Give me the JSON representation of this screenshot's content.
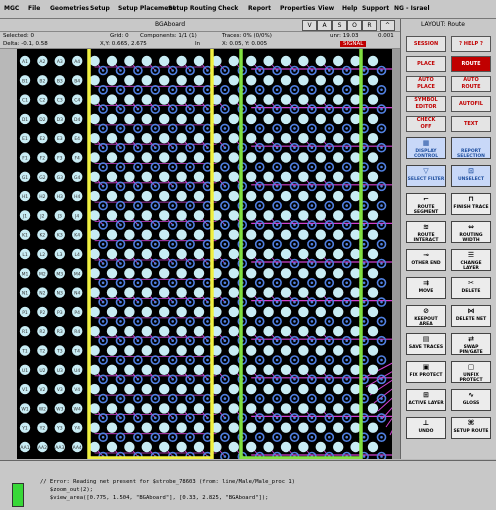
{
  "menu": [
    "MGC",
    "File",
    "Geometries",
    "Setup",
    "Setup Placement",
    "Setup Routing",
    "Check",
    "Report",
    "Properties",
    "View",
    "Help",
    "Support",
    "NG - Israel"
  ],
  "window": {
    "title": "BGAboard",
    "buttons": [
      "V",
      "A",
      "S",
      "O",
      "R",
      "^"
    ]
  },
  "status": {
    "selected": "Selected: 0",
    "delta": "Delta: -0.1, 0.58",
    "grid": "Grid: 0",
    "components": "Components: 1/1 (1)",
    "traces": "Traces: 0% (0/0%)",
    "unrouted": "unr: 19.03",
    "value": "0.001",
    "xy": "X,Y: 0.665, 2.675",
    "layer": "In",
    "pos2": "X: 0.05, Y: 0.005",
    "mode_badge": "SIGNAL"
  },
  "panel": {
    "title": "LAYOUT: Route",
    "text_buttons": [
      {
        "label": "SESSION",
        "style": "red"
      },
      {
        "label": "? HELP ?",
        "style": "red"
      },
      {
        "label": "PLACE",
        "style": "red"
      },
      {
        "label": "ROUTE",
        "style": "sel"
      },
      {
        "label": "AUTO\nPLACE",
        "style": "red"
      },
      {
        "label": "AUTO\nROUTE",
        "style": "red"
      },
      {
        "label": "SYMBOL\nEDITOR",
        "style": "red"
      },
      {
        "label": "AUTOFIL",
        "style": "red"
      },
      {
        "label": "CHECK\nOFF",
        "style": "red"
      },
      {
        "label": "TEXT",
        "style": "red"
      }
    ],
    "icon_buttons": [
      {
        "label": "DISPLAY\nCONTROL",
        "icon": "display-control-icon",
        "glyph": "▦",
        "style": "blue"
      },
      {
        "label": "REPORT\nSELECTION",
        "icon": "report-icon",
        "glyph": "",
        "style": "blue"
      },
      {
        "label": "SELECT\nFILTER",
        "icon": "filter-icon",
        "glyph": "▽",
        "style": "blue"
      },
      {
        "label": "UNSELECT",
        "icon": "unselect-icon",
        "glyph": "⊡",
        "style": "blue"
      },
      {
        "label": "ROUTE\nSEGMENT",
        "icon": "route-segment-icon",
        "glyph": "⌐",
        "style": ""
      },
      {
        "label": "FINISH\nTRACE",
        "icon": "finish-trace-icon",
        "glyph": "⊓",
        "style": ""
      },
      {
        "label": "ROUTE\nINTERACT",
        "icon": "route-interact-icon",
        "glyph": "≋",
        "style": ""
      },
      {
        "label": "ROUTING\nWIDTH",
        "icon": "routing-width-icon",
        "glyph": "⇔",
        "style": ""
      },
      {
        "label": "OTHER\nEND",
        "icon": "other-end-icon",
        "glyph": "⊸",
        "style": ""
      },
      {
        "label": "CHANGE\nLAYER",
        "icon": "change-layer-icon",
        "glyph": "☰",
        "style": ""
      },
      {
        "label": "MOVE",
        "icon": "move-icon",
        "glyph": "⇉",
        "style": ""
      },
      {
        "label": "DELETE",
        "icon": "delete-icon",
        "glyph": "✂",
        "style": ""
      },
      {
        "label": "KEEPOUT\nAREA",
        "icon": "keepout-icon",
        "glyph": "⊘",
        "style": ""
      },
      {
        "label": "DELETE\nNET",
        "icon": "delete-net-icon",
        "glyph": "⋈",
        "style": ""
      },
      {
        "label": "SAVE\nTRACES",
        "icon": "save-traces-icon",
        "glyph": "▤",
        "style": ""
      },
      {
        "label": "SWAP\nPIN/GATE",
        "icon": "swap-icon",
        "glyph": "⇄",
        "style": ""
      },
      {
        "label": "FIX\nPROTECT",
        "icon": "fix-icon",
        "glyph": "▣",
        "style": ""
      },
      {
        "label": "UNFIX\nPROTECT",
        "icon": "unfix-icon",
        "glyph": "▢",
        "style": ""
      },
      {
        "label": "ACTIVE\nLAYER",
        "icon": "active-layer-icon",
        "glyph": "⊞",
        "style": ""
      },
      {
        "label": "GLOSS",
        "icon": "gloss-icon",
        "glyph": "∿",
        "style": ""
      },
      {
        "label": "UNDO",
        "icon": "undo-icon",
        "glyph": "⊥",
        "style": ""
      },
      {
        "label": "SETUP\nROUTE",
        "icon": "setup-route-icon",
        "glyph": "⌘",
        "style": ""
      }
    ]
  },
  "console": {
    "lines": [
      "// Error: Reading net present for $strobe_78603 (from: line/Male/Male_proc 1)",
      "   $zoom_out(2);",
      "   $view_area([0.775, 1.504, \"BGAboard\"], [0.33, 2.825, \"BGAboard\"]);"
    ]
  },
  "colors": {
    "canvas": "#000000",
    "pad": "#c8ecf4",
    "via": "#5080e0",
    "trace": "#d040d0",
    "net_line": "#a0a0ff",
    "highlight_yellow": "#f0f040",
    "highlight_green": "#80e040"
  },
  "pad_labels": [
    [
      "A",
      "B",
      "C",
      "D",
      "E",
      "F",
      "G",
      "H",
      "J",
      "K",
      "L",
      "M",
      "N",
      "P",
      "R",
      "T",
      "U",
      "V",
      "W",
      "Y",
      "AA"
    ],
    [
      "1",
      "2",
      "3",
      "4",
      "5",
      "6",
      "7",
      "8",
      "9",
      "10",
      "11",
      "12",
      "13",
      "14",
      "15",
      "16",
      "17",
      "18",
      "19",
      "20",
      "21",
      "22"
    ]
  ]
}
